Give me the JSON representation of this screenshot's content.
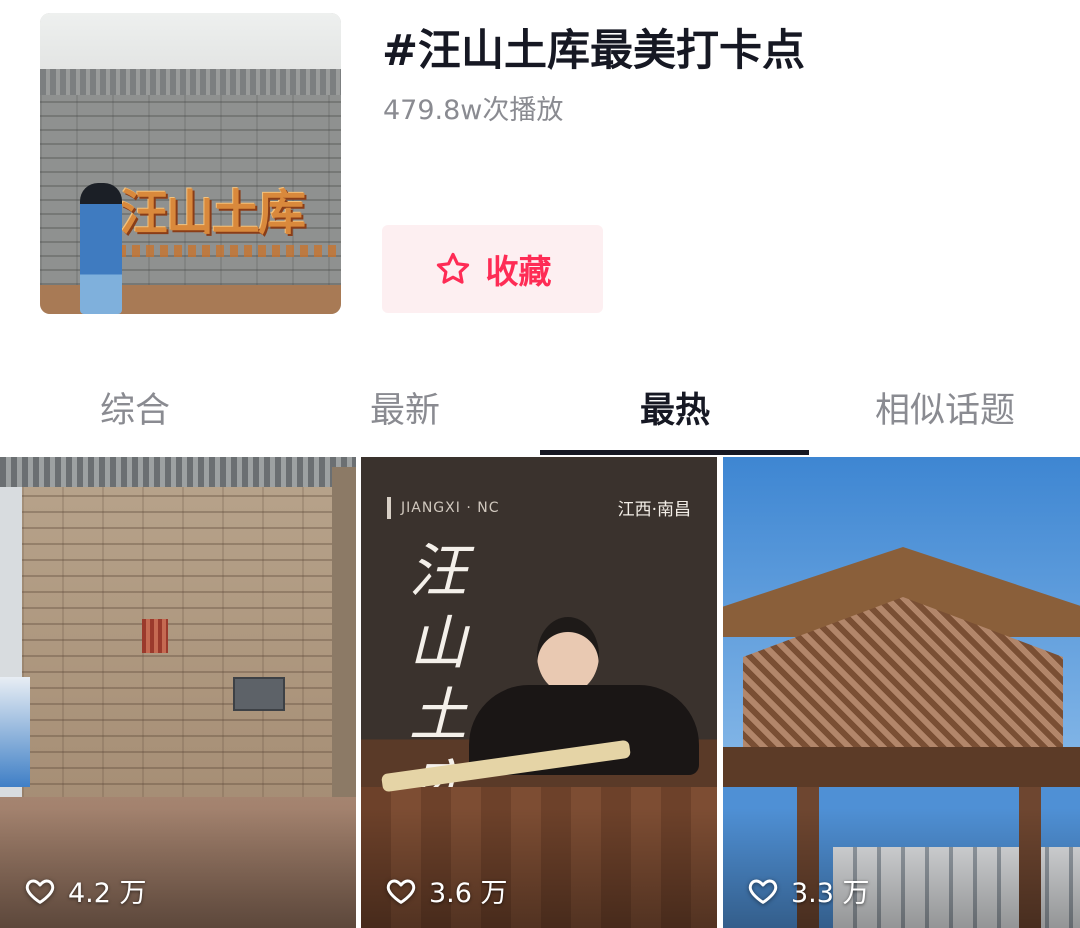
{
  "header": {
    "title": "#汪山土库最美打卡点",
    "play_count": "479.8w次播放",
    "cover_sign": "汪山土库",
    "favorite_label": "收藏",
    "favorite_icon": "star-outline-icon",
    "accent_color": "#fe2c55"
  },
  "tabs": [
    {
      "label": "综合",
      "active": false
    },
    {
      "label": "最新",
      "active": false
    },
    {
      "label": "最热",
      "active": true
    },
    {
      "label": "相似话题",
      "active": false
    }
  ],
  "videos": [
    {
      "likes": "4.2 万",
      "like_icon": "heart-outline-icon"
    },
    {
      "likes": "3.6 万",
      "like_icon": "heart-outline-icon",
      "tag": "JIANGXI · NC",
      "location": "江西·南昌",
      "calligraphy": "汪山土库"
    },
    {
      "likes": "3.3 万",
      "like_icon": "heart-outline-icon"
    }
  ]
}
